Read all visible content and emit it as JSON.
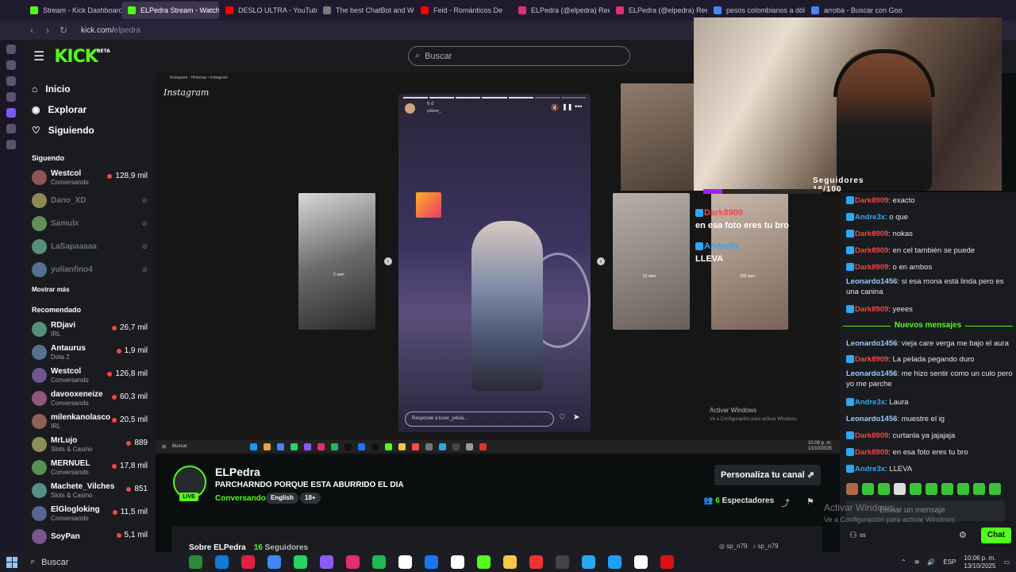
{
  "browser": {
    "tabs": [
      {
        "label": "Stream - Kick Dashboard",
        "color": "#53fc18"
      },
      {
        "label": "ELPedra Stream - Watch Live",
        "color": "#53fc18",
        "active": true
      },
      {
        "label": "DESLO ULTRA - YouTube",
        "color": "#ff0000"
      },
      {
        "label": "The best ChatBot and Website",
        "color": "#7a7a7a"
      },
      {
        "label": "Feid - Románticos De",
        "color": "#ff0000"
      },
      {
        "label": "ELPedra (@elpedra) Reels",
        "color": "#e1306c"
      },
      {
        "label": "ELPedra (@elpedra) Reels",
        "color": "#e1306c"
      },
      {
        "label": "pesos colombianos a dólares",
        "color": "#4285f4"
      },
      {
        "label": "arroba - Buscar con Google",
        "color": "#4285f4"
      }
    ],
    "url_domain": "kick.com/",
    "url_path": "elpedra"
  },
  "header": {
    "logo": "KICK",
    "logo_beta": "BETA",
    "search_placeholder": "Buscar"
  },
  "leftnav": {
    "main": [
      {
        "label": "Inicio",
        "icon": "home-icon"
      },
      {
        "label": "Explorar",
        "icon": "compass-icon"
      },
      {
        "label": "Siguiendo",
        "icon": "heart-icon"
      }
    ],
    "following_title": "Siguendo",
    "following": [
      {
        "name": "Westcol",
        "sub": "Conversando",
        "viewers": "128,9 mil",
        "live": true
      },
      {
        "name": "Dano_XD",
        "live": false
      },
      {
        "name": "Samulx",
        "live": false
      },
      {
        "name": "LaSapaaaaa",
        "live": false
      },
      {
        "name": "yulianfino4",
        "live": false
      }
    ],
    "show_more": "Mostrar más",
    "recommended_title": "Recomendado",
    "recommended": [
      {
        "name": "RDjavi",
        "sub": "IRL",
        "viewers": "26,7 mil"
      },
      {
        "name": "Antaurus",
        "sub": "Dota 2",
        "viewers": "1,9 mil"
      },
      {
        "name": "Westcol",
        "sub": "Conversando",
        "viewers": "126,8 mil"
      },
      {
        "name": "davooxeneize",
        "sub": "Conversando",
        "viewers": "60,3 mil"
      },
      {
        "name": "milenkanolasco",
        "sub": "IRL",
        "viewers": "20,5 mil"
      },
      {
        "name": "MrLujo",
        "sub": "Slots & Casino",
        "viewers": "889"
      },
      {
        "name": "MERNUEL",
        "sub": "Conversando",
        "viewers": "17,8 mil"
      },
      {
        "name": "Machete_Vilches",
        "sub": "Slots & Casino",
        "viewers": "851"
      },
      {
        "name": "ElGlogloking",
        "sub": "Conversando",
        "viewers": "11,5 mil"
      },
      {
        "name": "SoyPan",
        "sub": "",
        "viewers": "5,1 mil"
      }
    ]
  },
  "stream": {
    "ig_bar": "Instagram - Historias • Instagram",
    "ig_logo": "Instagram",
    "story_time": "6 d",
    "story_user": "pdiane_",
    "story_reply": "Responde a louvr_p4ula...",
    "followers": "Seguidores 16/100",
    "followers_progress": 0.16,
    "overlay": [
      {
        "user": "Dark8909",
        "text": "en esa foto eres tu bro"
      },
      {
        "user": "Andre3x",
        "text": "LLEVA"
      }
    ],
    "thumb_times": [
      "2 sem",
      "52 sem",
      "155 sem"
    ],
    "activate_title": "Activar Windows",
    "activate_sub": "Ve a Configuración para activar Windows.",
    "inner_search": "Buscar",
    "inner_time": "10:06 p. m.",
    "inner_date": "13/10/2025"
  },
  "channel": {
    "name": "ELPedra",
    "title": "PARCHARNDO PORQUE ESTA ABURRIDO EL DIA",
    "category": "Conversando",
    "tags": [
      "English",
      "18+"
    ],
    "live": "LIVE",
    "customize": "Personaliza tu canal",
    "viewers_count": "6",
    "viewers_label": "Espectadores",
    "about": "Sobre ELPedra",
    "followers_count": "16",
    "followers_label": "Seguidores",
    "social1": "sp_n79",
    "social2": "sp_n79"
  },
  "chat": {
    "messages": [
      {
        "user": "Dark8909",
        "text": "exacto",
        "badge": true,
        "color": "#f04848"
      },
      {
        "user": "Andre3x",
        "text": "o que",
        "badge": true,
        "color": "#2ea8f0"
      },
      {
        "user": "Dark8909",
        "text": "nokas",
        "badge": true,
        "color": "#f04848"
      },
      {
        "user": "Dark8909",
        "text": "en cel también se puede",
        "badge": true,
        "color": "#f04848"
      },
      {
        "user": "Dark8909",
        "text": "o en ambos",
        "badge": true,
        "color": "#f04848"
      },
      {
        "user": "Leonardo1456",
        "text": "si esa mona está linda pero es una canina",
        "badge": false,
        "color": "#9ecbff"
      },
      {
        "user": "Dark8909",
        "text": "yeees",
        "badge": true,
        "color": "#f04848"
      },
      {
        "user": "Leonardo1456",
        "text": "vieja care verga me bajo el aura",
        "badge": false,
        "color": "#9ecbff"
      },
      {
        "user": "Dark8909",
        "text": "La pelada pegando duro",
        "badge": true,
        "color": "#f04848"
      },
      {
        "user": "Leonardo1456",
        "text": "me hizo sentir como un culo pero yo me parche",
        "badge": false,
        "color": "#9ecbff"
      },
      {
        "user": "Andre3x",
        "text": "Laura",
        "badge": true,
        "color": "#2ea8f0"
      },
      {
        "user": "Leonardo1456",
        "text": "muestre el ig",
        "badge": false,
        "color": "#9ecbff"
      },
      {
        "user": "Dark8909",
        "text": "curtanla ya jajajaja",
        "badge": true,
        "color": "#f04848"
      },
      {
        "user": "Dark8909",
        "text": "en esa foto eres tu bro",
        "badge": true,
        "color": "#f04848"
      },
      {
        "user": "Andre3x",
        "text": "LLEVA",
        "badge": true,
        "color": "#2ea8f0"
      }
    ],
    "new_messages": "Nuevos mensajes",
    "input_placeholder": "Enviar un mensaje",
    "activate_title": "Activar Windows",
    "activate_sub": "Ve a Configuración para activar Windows.",
    "send": "Chat"
  },
  "taskbar": {
    "search": "Buscar",
    "time": "10:06 p. m.",
    "date": "13/10/2025",
    "lang": "ESP"
  }
}
